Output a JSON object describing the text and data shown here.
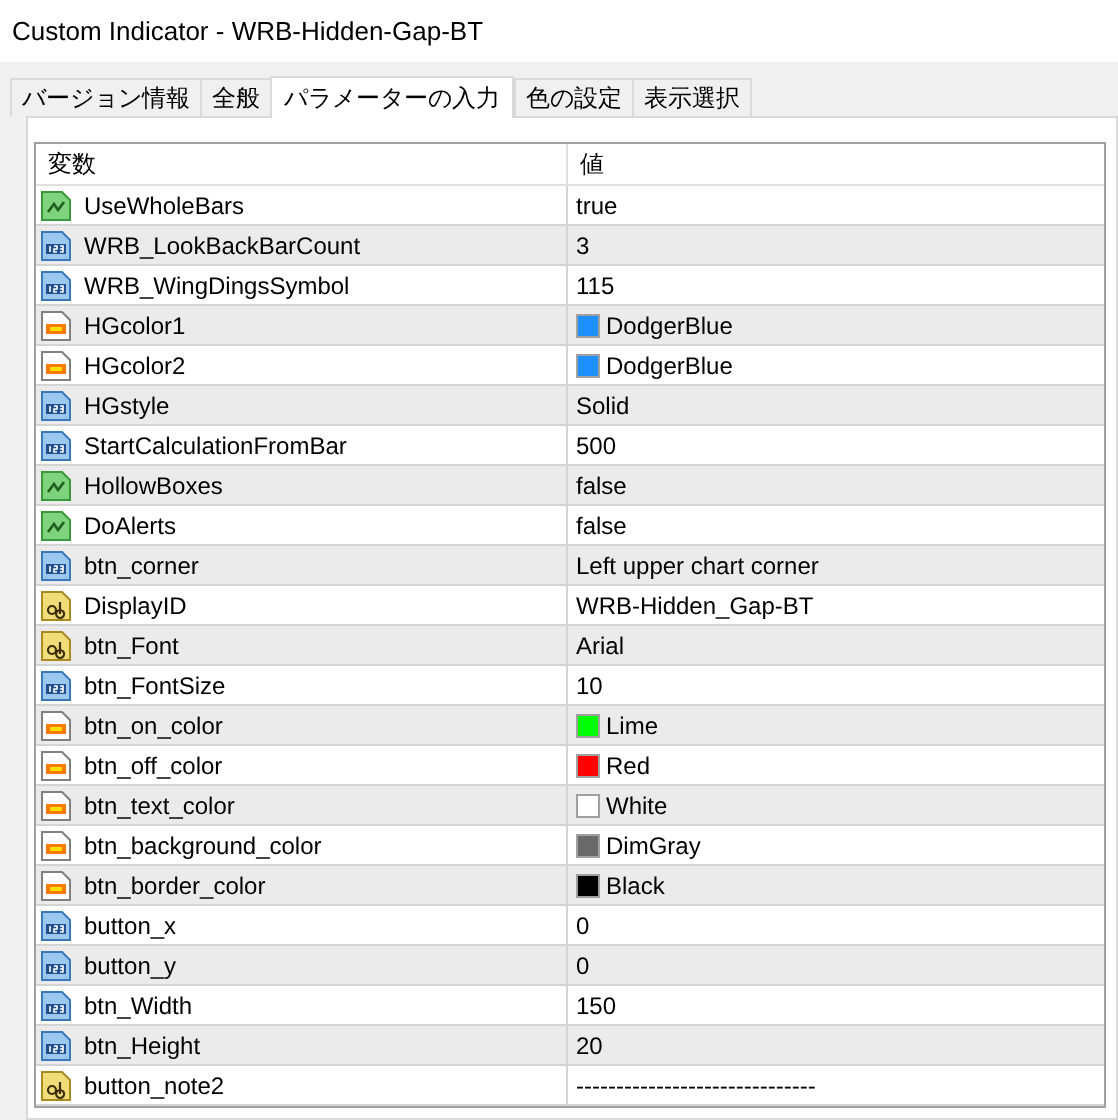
{
  "window": {
    "title": "Custom Indicator - WRB-Hidden-Gap-BT"
  },
  "tabs": [
    {
      "label": "バージョン情報",
      "selected": false
    },
    {
      "label": "全般",
      "selected": false
    },
    {
      "label": "パラメーターの入力",
      "selected": true
    },
    {
      "label": "色の設定",
      "selected": false
    },
    {
      "label": "表示選択",
      "selected": false
    }
  ],
  "table": {
    "columns": [
      "変数",
      "値"
    ],
    "rows": [
      {
        "kind": "bool",
        "name": "UseWholeBars",
        "value": "true"
      },
      {
        "kind": "int",
        "name": "WRB_LookBackBarCount",
        "value": "3"
      },
      {
        "kind": "int",
        "name": "WRB_WingDingsSymbol",
        "value": "115"
      },
      {
        "kind": "color",
        "name": "HGcolor1",
        "value": "DodgerBlue",
        "color": "#1e90ff"
      },
      {
        "kind": "color",
        "name": "HGcolor2",
        "value": "DodgerBlue",
        "color": "#1e90ff"
      },
      {
        "kind": "int",
        "name": "HGstyle",
        "value": "Solid"
      },
      {
        "kind": "int",
        "name": "StartCalculationFromBar",
        "value": "500"
      },
      {
        "kind": "bool",
        "name": "HollowBoxes",
        "value": "false"
      },
      {
        "kind": "bool",
        "name": "DoAlerts",
        "value": "false"
      },
      {
        "kind": "int",
        "name": "btn_corner",
        "value": "Left upper chart corner"
      },
      {
        "kind": "string",
        "name": "DisplayID",
        "value": "WRB-Hidden_Gap-BT"
      },
      {
        "kind": "string",
        "name": "btn_Font",
        "value": "Arial"
      },
      {
        "kind": "int",
        "name": "btn_FontSize",
        "value": "10"
      },
      {
        "kind": "color",
        "name": "btn_on_color",
        "value": "Lime",
        "color": "#00ff00"
      },
      {
        "kind": "color",
        "name": "btn_off_color",
        "value": "Red",
        "color": "#ff0000"
      },
      {
        "kind": "color",
        "name": "btn_text_color",
        "value": "White",
        "color": "#ffffff"
      },
      {
        "kind": "color",
        "name": "btn_background_color",
        "value": "DimGray",
        "color": "#696969"
      },
      {
        "kind": "color",
        "name": "btn_border_color",
        "value": "Black",
        "color": "#000000"
      },
      {
        "kind": "int",
        "name": "button_x",
        "value": "0"
      },
      {
        "kind": "int",
        "name": "button_y",
        "value": "0"
      },
      {
        "kind": "int",
        "name": "btn_Width",
        "value": "150"
      },
      {
        "kind": "int",
        "name": "btn_Height",
        "value": "20"
      },
      {
        "kind": "string",
        "name": "button_note2",
        "value": "------------------------------"
      }
    ]
  }
}
